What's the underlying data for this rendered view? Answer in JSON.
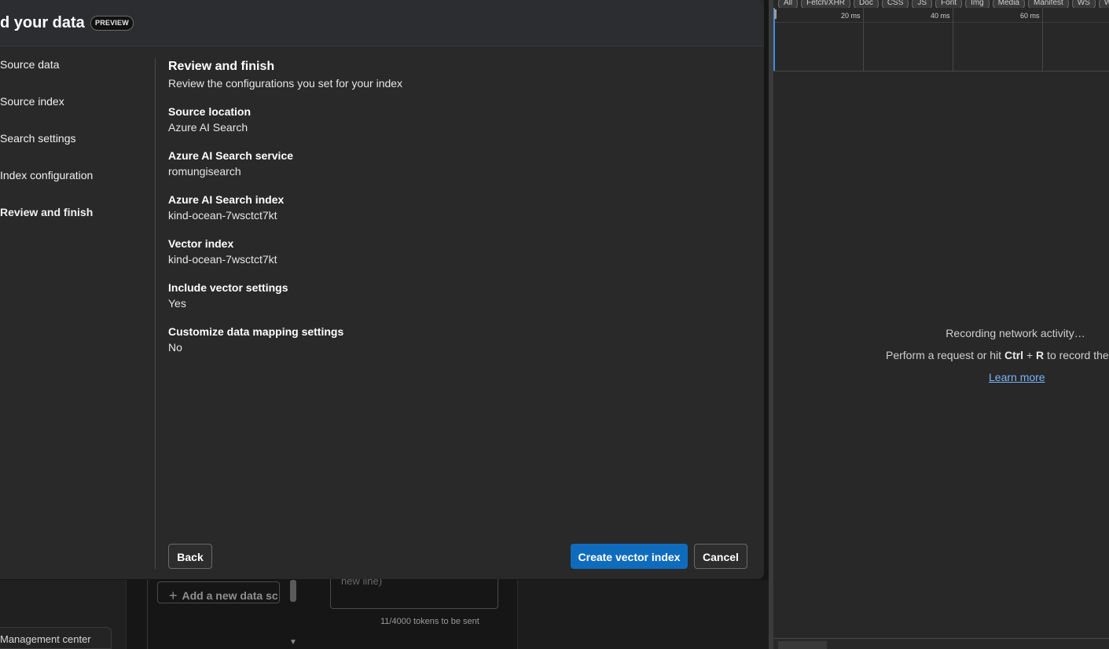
{
  "background": {
    "management_center": "Management center",
    "add_data_source": "Add a new data sc",
    "chat_placeholder": "new line)",
    "tokens": "11/4000 tokens to be sent"
  },
  "dialog": {
    "title": "d your data",
    "badge": "PREVIEW",
    "steps": [
      {
        "label": "Source data"
      },
      {
        "label": "Source index"
      },
      {
        "label": "Search settings"
      },
      {
        "label": "Index configuration"
      },
      {
        "label": "Review and finish"
      }
    ],
    "content": {
      "heading": "Review and finish",
      "description": "Review the configurations you set for your index",
      "fields": [
        {
          "label": "Source location",
          "value": "Azure AI Search"
        },
        {
          "label": "Azure AI Search service",
          "value": "romungisearch"
        },
        {
          "label": "Azure AI Search index",
          "value": "kind-ocean-7wsctct7kt"
        },
        {
          "label": "Vector index",
          "value": "kind-ocean-7wsctct7kt"
        },
        {
          "label": "Include vector settings",
          "value": "Yes"
        },
        {
          "label": "Customize data mapping settings",
          "value": "No"
        }
      ]
    },
    "buttons": {
      "back": "Back",
      "create": "Create vector index",
      "cancel": "Cancel"
    }
  },
  "devtools": {
    "filters": [
      "All",
      "Fetch/XHR",
      "Doc",
      "CSS",
      "JS",
      "Font",
      "Img",
      "Media",
      "Manifest",
      "WS",
      "Wasm"
    ],
    "ticks": [
      "20 ms",
      "40 ms",
      "60 ms"
    ],
    "recording": "Recording network activity…",
    "hint_prefix": "Perform a request or hit ",
    "hint_key1": "Ctrl",
    "hint_plus": " + ",
    "hint_key2": "R",
    "hint_suffix": " to record the reload.",
    "learn_more": "Learn more"
  }
}
